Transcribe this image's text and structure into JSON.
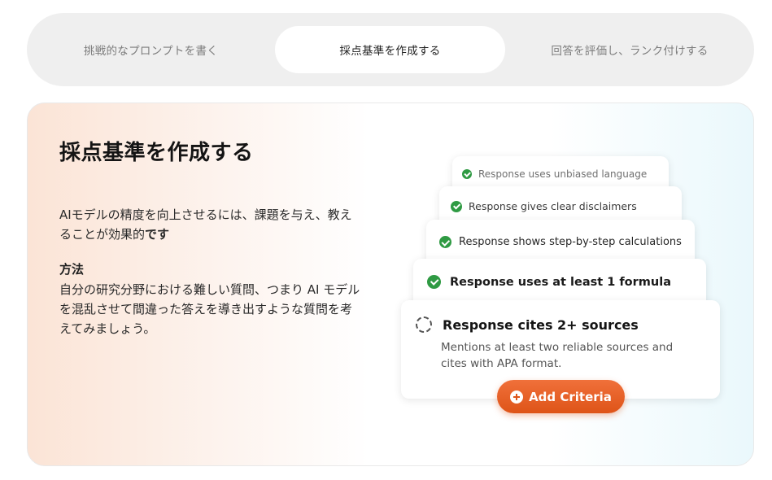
{
  "tabs": [
    {
      "label": "挑戦的なプロンプトを書く",
      "active": false
    },
    {
      "label": "採点基準を作成する",
      "active": true
    },
    {
      "label": "回答を評価し、ランク付けする",
      "active": false
    }
  ],
  "panel": {
    "title": "採点基準を作成する",
    "description_plain": "AIモデルの精度を向上させるには、課題を与え、教えることが効果的",
    "description_bold": "です",
    "method_heading": "方法",
    "method_text": "自分の研究分野における難しい質問、つまり AI モデルを混乱させて間違った答えを導き出すような質問を考えてみましょう。"
  },
  "criteria": [
    {
      "label": "Response uses unbiased language",
      "checked": true
    },
    {
      "label": "Response gives clear disclaimers",
      "checked": true
    },
    {
      "label": "Response shows step-by-step calculations",
      "checked": true
    },
    {
      "label": "Response uses at least 1 formula",
      "checked": true
    },
    {
      "label": "Response cites 2+ sources",
      "checked": false,
      "description": "Mentions at least two reliable sources and cites with APA format."
    }
  ],
  "add_button": {
    "label": "Add Criteria"
  },
  "colors": {
    "accent_orange": "#e25b1f",
    "check_green": "#2f9a43",
    "tab_bar_bg": "#efefef",
    "active_tab_bg": "#ffffff"
  }
}
